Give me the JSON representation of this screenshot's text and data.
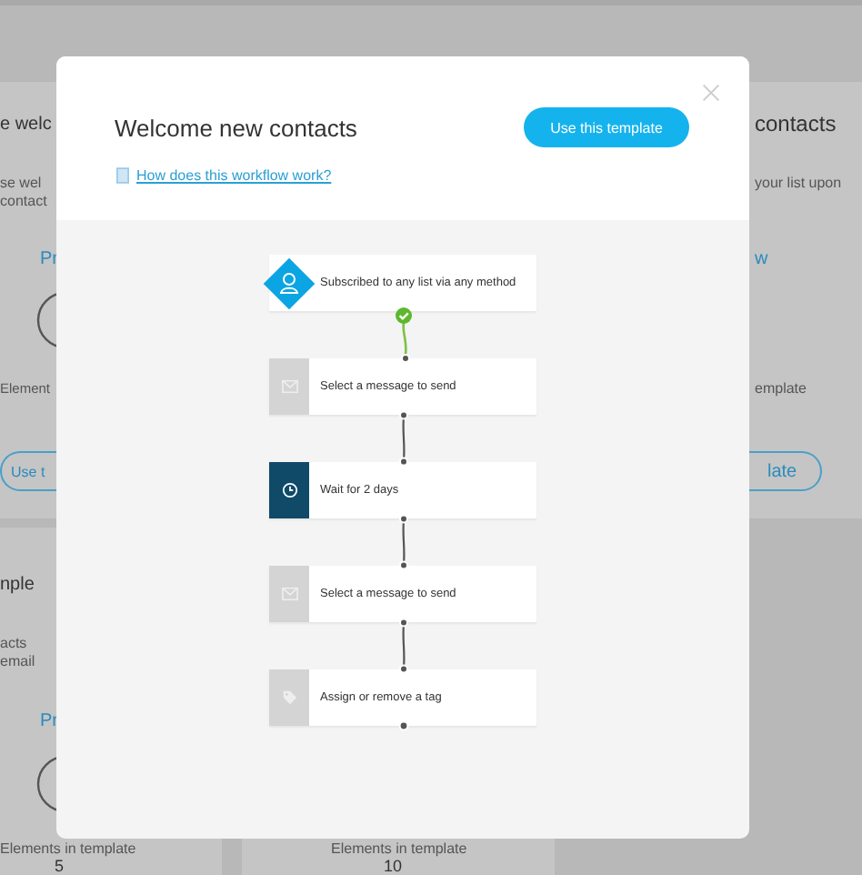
{
  "background": {
    "cards": [
      {
        "title": "e welc",
        "description": [
          "se wel",
          "contact"
        ],
        "link": "Pr",
        "stat_label": "Element",
        "button": "Use t"
      },
      {
        "title": "contacts",
        "description": [
          "your list upon"
        ],
        "link": "w",
        "stat_label": "emplate",
        "button": "late"
      },
      {
        "title": "nple",
        "description": [
          "acts",
          "email"
        ],
        "link": "Pr",
        "stat_label": "Elements in template",
        "stat_value": "5"
      },
      {
        "stat_label": "Elements in template",
        "stat_value": "10"
      }
    ]
  },
  "modal": {
    "title": "Welcome new contacts",
    "button": "Use this template",
    "help_link": "How does this workflow work?",
    "steps": [
      {
        "kind": "trigger",
        "label": "Subscribed to any list via any method",
        "completed": true
      },
      {
        "kind": "message",
        "label": "Select a message to send",
        "completed": false
      },
      {
        "kind": "wait",
        "label": "Wait for 2 days",
        "completed": false
      },
      {
        "kind": "message",
        "label": "Select a message to send",
        "completed": false
      },
      {
        "kind": "tag",
        "label": "Assign or remove a tag",
        "completed": false
      }
    ]
  }
}
